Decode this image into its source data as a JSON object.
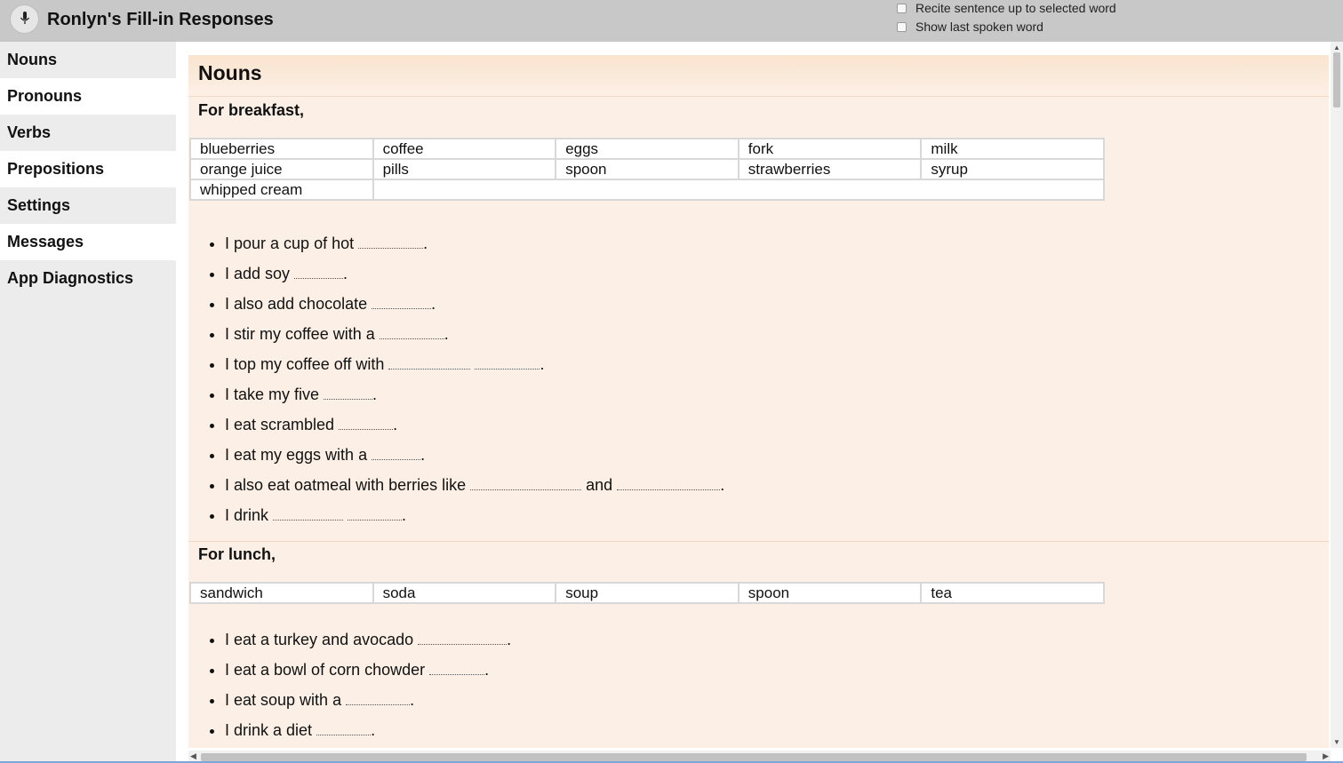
{
  "app": {
    "title": "Ronlyn's Fill-in Responses",
    "options": [
      {
        "label": "Recite sentence up to selected word",
        "checked": false
      },
      {
        "label": "Show last spoken word",
        "checked": false
      }
    ]
  },
  "sidebar": {
    "items": [
      {
        "label": "Nouns"
      },
      {
        "label": "Pronouns"
      },
      {
        "label": "Verbs"
      },
      {
        "label": "Prepositions"
      },
      {
        "label": "Settings"
      },
      {
        "label": "Messages"
      },
      {
        "label": "App Diagnostics"
      }
    ]
  },
  "main": {
    "section_title": "Nouns",
    "breakfast": {
      "heading": "For breakfast,",
      "words": [
        [
          "blueberries",
          "coffee",
          "eggs",
          "fork",
          "milk"
        ],
        [
          "orange juice",
          "pills",
          "spoon",
          "strawberries",
          "syrup"
        ],
        [
          "whipped cream"
        ]
      ],
      "sentences": [
        {
          "parts": [
            "I pour a cup of hot",
            "."
          ]
        },
        {
          "parts": [
            "I add soy",
            "."
          ]
        },
        {
          "parts": [
            "I also add chocolate",
            "."
          ]
        },
        {
          "parts": [
            "I stir my coffee with a",
            "."
          ]
        },
        {
          "parts": [
            "I top my coffee off with",
            "."
          ]
        },
        {
          "parts": [
            "I take my five",
            "."
          ]
        },
        {
          "parts": [
            "I eat scrambled",
            "."
          ]
        },
        {
          "parts": [
            "I eat my eggs with a",
            "."
          ]
        },
        {
          "parts": [
            "I also eat oatmeal with berries like",
            "and",
            "."
          ]
        },
        {
          "parts": [
            "I drink",
            "."
          ]
        }
      ]
    },
    "lunch": {
      "heading": "For lunch,",
      "words": [
        [
          "sandwich",
          "soda",
          "soup",
          "spoon",
          "tea"
        ]
      ],
      "sentences": [
        {
          "parts": [
            "I eat a turkey and avocado",
            "."
          ]
        },
        {
          "parts": [
            "I eat a bowl of corn chowder",
            "."
          ]
        },
        {
          "parts": [
            "I eat soup with a",
            "."
          ]
        },
        {
          "parts": [
            "I drink a diet",
            "."
          ]
        }
      ]
    }
  },
  "icons": {
    "mic": "microphone-icon",
    "scroll_up": "arrow-up-icon",
    "scroll_down": "arrow-down-icon",
    "scroll_left": "arrow-left-icon",
    "scroll_right": "arrow-right-icon"
  },
  "colors": {
    "topbar": "#c8c8c8",
    "sidebar": "#ececec",
    "content_bg": "#fcf0e6",
    "header_gradient": "#f9e4cf"
  }
}
